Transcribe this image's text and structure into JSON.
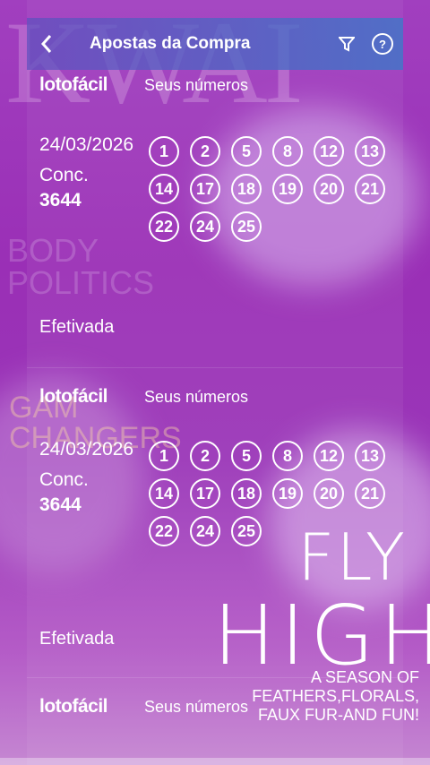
{
  "header": {
    "title": "Apostas da Compra",
    "back_icon": "chevron-left-icon",
    "filter_icon": "filter-icon",
    "help_label": "?"
  },
  "background": {
    "kwai": "KWAI",
    "body_politics": "BODY POLITICS",
    "game_changers_1": "GAM",
    "game_changers_2": "CHANGERS",
    "fly": "FLY",
    "high": "HIGH",
    "season_1": "A SEASON OF",
    "season_2": "FEATHERS,FLORALS,",
    "season_3": "FAUX FUR-AND FUN!"
  },
  "bets": [
    {
      "brand": "lotofácil",
      "seus_label": "Seus números",
      "date": "24/03/2026",
      "conc_label": "Conc.",
      "conc_number": "3644",
      "numbers": [
        "1",
        "2",
        "5",
        "8",
        "12",
        "13",
        "14",
        "17",
        "18",
        "19",
        "20",
        "21",
        "22",
        "24",
        "25"
      ],
      "status": "Efetivada"
    },
    {
      "brand": "lotofácil",
      "seus_label": "Seus números",
      "date": "24/03/2026",
      "conc_label": "Conc.",
      "conc_number": "3644",
      "numbers": [
        "1",
        "2",
        "5",
        "8",
        "12",
        "13",
        "14",
        "17",
        "18",
        "19",
        "20",
        "21",
        "22",
        "24",
        "25"
      ],
      "status": "Efetivada"
    },
    {
      "brand": "lotofácil",
      "seus_label": "Seus números"
    }
  ]
}
